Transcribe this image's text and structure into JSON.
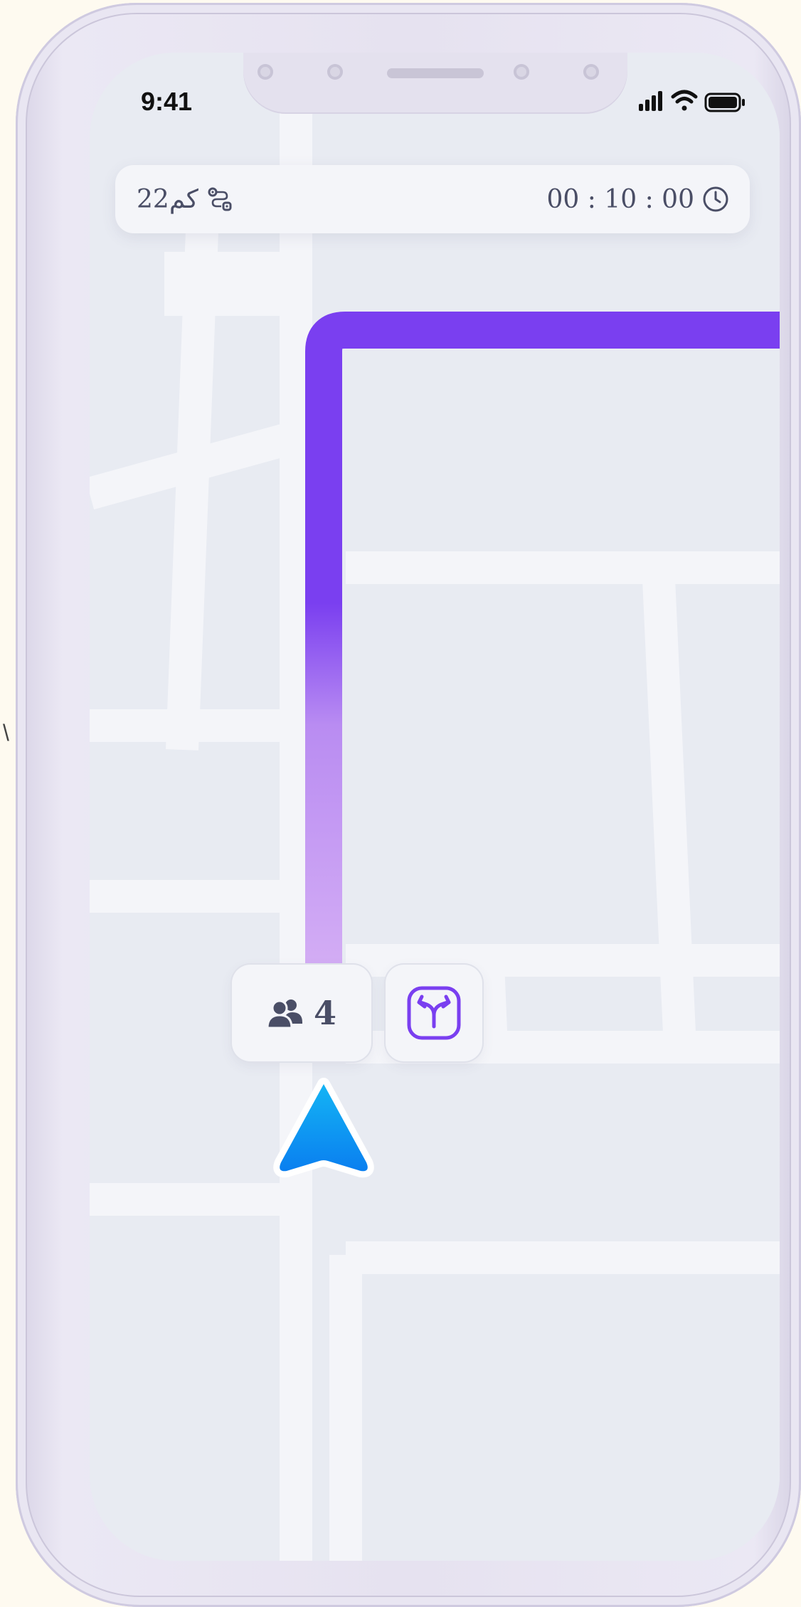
{
  "status_bar": {
    "time": "9:41",
    "icons": [
      "cellular-signal-icon",
      "wifi-icon",
      "battery-icon"
    ]
  },
  "trip_info": {
    "distance": "22كم",
    "distance_icon": "route-icon",
    "elapsed_time": "00 : 10 : 00",
    "time_icon": "clock-icon"
  },
  "bottom_controls": {
    "passengers_count": "4",
    "passengers_icon": "users-icon",
    "route_icon": "split-route-icon"
  },
  "colors": {
    "route_start": "#dcb8f5",
    "route_end": "#7a3ff0",
    "nav_arrow": "#0a8cf0",
    "map_block": "#e8ebf2",
    "map_road": "#f4f5f9",
    "accent": "#7a3ff0"
  }
}
